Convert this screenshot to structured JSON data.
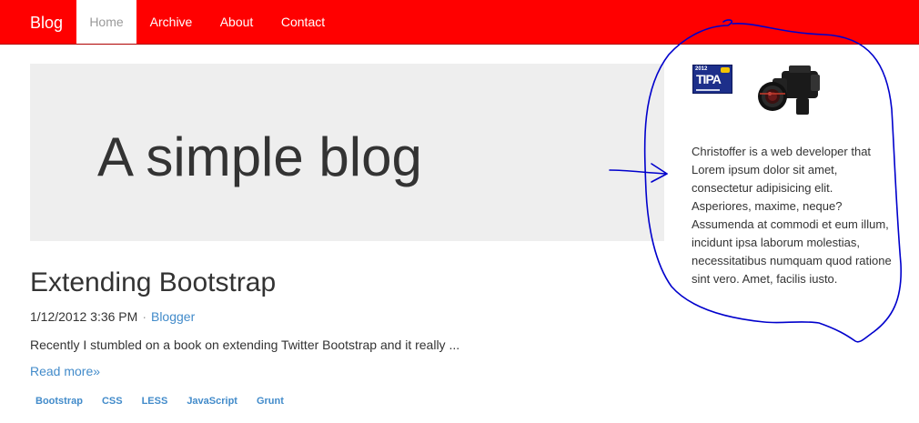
{
  "navbar": {
    "brand": "Blog",
    "items": [
      {
        "label": "Home",
        "active": true
      },
      {
        "label": "Archive",
        "active": false
      },
      {
        "label": "About",
        "active": false
      },
      {
        "label": "Contact",
        "active": false
      }
    ],
    "color": "#ff0000"
  },
  "jumbotron": {
    "title": "A simple blog"
  },
  "post": {
    "title": "Extending Bootstrap",
    "date": "1/12/2012 3:36 PM",
    "separator": "·",
    "author": "Blogger",
    "excerpt": "Recently I stumbled on a book on extending Twitter Bootstrap and it really ...",
    "read_more": "Read more»",
    "tags": [
      "Bootstrap",
      "CSS",
      "LESS",
      "JavaScript",
      "Grunt"
    ]
  },
  "sidebar": {
    "award_logo": {
      "year": "2012",
      "name": "TIPA"
    },
    "bio": "Christoffer is a web developer that Lorem ipsum dolor sit amet, consectetur adipisicing elit. Asperiores, maxime, neque? Assumenda at commodi et eum illum, incidunt ipsa laborum molestias, necessitatibus numquam quod ratione sint vero. Amet, facilis iusto."
  },
  "colors": {
    "link": "#428bca",
    "jumbotron_bg": "#eeeeee",
    "annotation": "#0000cc"
  }
}
